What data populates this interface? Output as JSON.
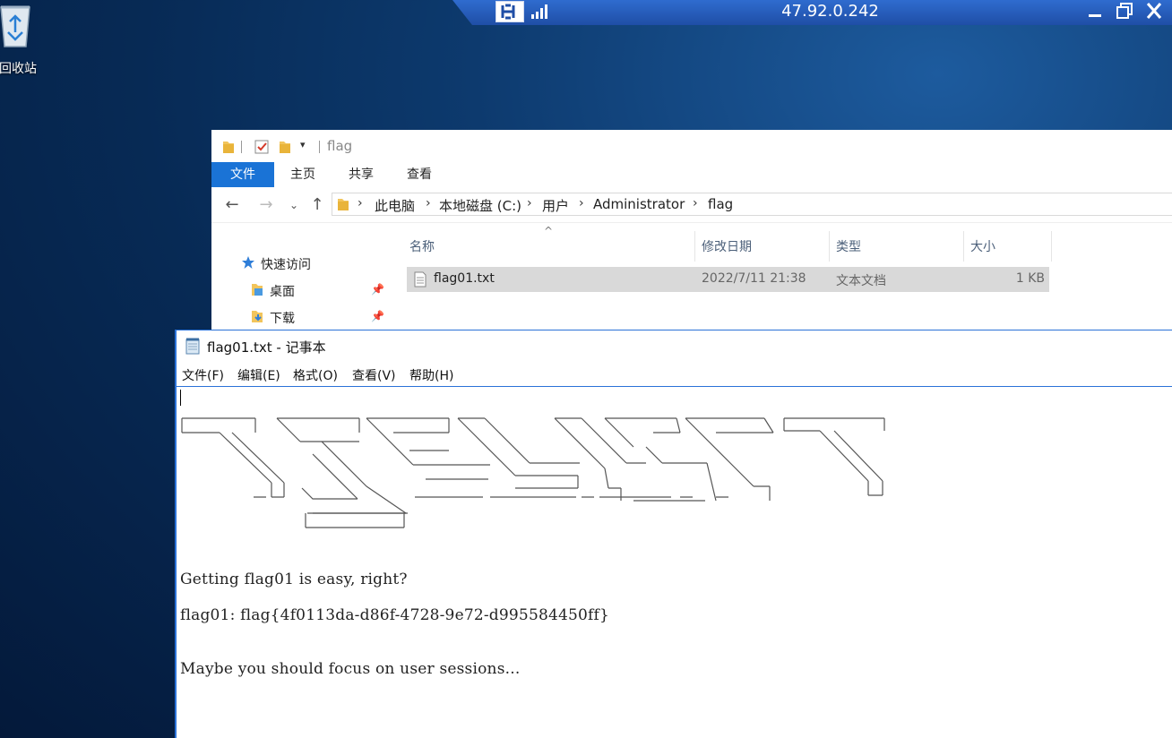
{
  "desktop": {
    "recycle_bin_label": "回收站"
  },
  "rdp": {
    "host": "47.92.0.242",
    "icons": [
      "pin-icon",
      "signal-icon",
      "minimize-icon",
      "restore-icon",
      "close-icon"
    ]
  },
  "explorer": {
    "title": "flag",
    "tabs": [
      "文件",
      "主页",
      "共享",
      "查看"
    ],
    "breadcrumb": [
      "此电脑",
      "本地磁盘 (C:)",
      "用户",
      "Administrator",
      "flag"
    ],
    "nav": {
      "quick_access": "快速访问",
      "desktop": "桌面",
      "downloads": "下载"
    },
    "columns": [
      "名称",
      "修改日期",
      "类型",
      "大小"
    ],
    "files": [
      {
        "name": "flag01.txt",
        "modified": "2022/7/11 21:38",
        "type": "文本文档",
        "size": "1 KB"
      }
    ]
  },
  "notepad": {
    "title": "flag01.txt - 记事本",
    "menu": [
      "文件(F)",
      "编辑(E)",
      "格式(O)",
      "查看(V)",
      "帮助(H)"
    ],
    "lines": {
      "line1": "Getting flag01 is easy, right?",
      "line2": "flag01: flag{4f0113da-d86f-4728-9e72-d995584450ff}",
      "line3": "Maybe you should focus on user sessions..."
    }
  },
  "colors": {
    "accent": "#1a73d6",
    "selected_row": "#d9d9d9",
    "desktop_bg": "#0d3a6e"
  }
}
